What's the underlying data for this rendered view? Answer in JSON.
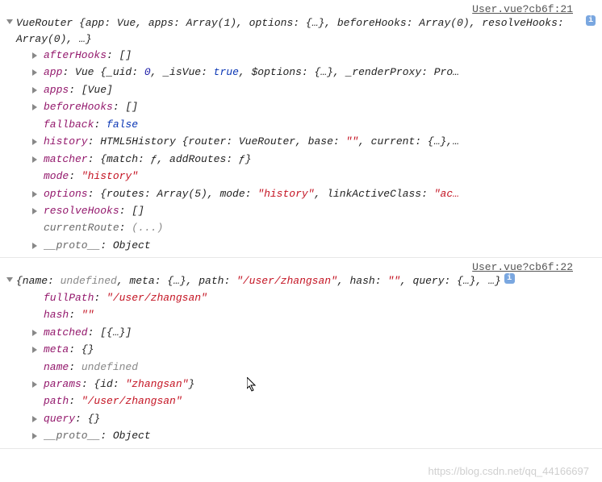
{
  "entries": [
    {
      "source": "User.vue?cb6f:21",
      "header": "VueRouter {app: Vue, apps: Array(1), options: {…}, beforeHooks: Array(0), resolveHooks: Array(0), …}",
      "props": [
        {
          "expandable": true,
          "key": "afterHooks",
          "keyClass": "p-key",
          "valueParts": [
            {
              "t": "[]",
              "c": "p-obj"
            }
          ]
        },
        {
          "expandable": true,
          "key": "app",
          "keyClass": "p-key",
          "valueParts": [
            {
              "t": "Vue {_uid: ",
              "c": "p-obj"
            },
            {
              "t": "0",
              "c": "p-num"
            },
            {
              "t": ", _isVue: ",
              "c": "p-obj"
            },
            {
              "t": "true",
              "c": "p-bool"
            },
            {
              "t": ", $options: {…}, _renderProxy: Pro…",
              "c": "p-obj"
            }
          ]
        },
        {
          "expandable": true,
          "key": "apps",
          "keyClass": "p-key",
          "valueParts": [
            {
              "t": "[Vue]",
              "c": "p-obj"
            }
          ]
        },
        {
          "expandable": true,
          "key": "beforeHooks",
          "keyClass": "p-key",
          "valueParts": [
            {
              "t": "[]",
              "c": "p-obj"
            }
          ]
        },
        {
          "expandable": false,
          "key": "fallback",
          "keyClass": "p-key",
          "valueParts": [
            {
              "t": "false",
              "c": "p-bool"
            }
          ]
        },
        {
          "expandable": true,
          "key": "history",
          "keyClass": "p-key",
          "valueParts": [
            {
              "t": "HTML5History {router: VueRouter, base: ",
              "c": "p-obj"
            },
            {
              "t": "\"\"",
              "c": "p-str"
            },
            {
              "t": ", current: {…},…",
              "c": "p-obj"
            }
          ]
        },
        {
          "expandable": true,
          "key": "matcher",
          "keyClass": "p-key",
          "valueParts": [
            {
              "t": "{match: ",
              "c": "p-obj"
            },
            {
              "t": "ƒ",
              "c": "p-func"
            },
            {
              "t": ", addRoutes: ",
              "c": "p-obj"
            },
            {
              "t": "ƒ",
              "c": "p-func"
            },
            {
              "t": "}",
              "c": "p-obj"
            }
          ]
        },
        {
          "expandable": false,
          "key": "mode",
          "keyClass": "p-key",
          "valueParts": [
            {
              "t": "\"history\"",
              "c": "p-str"
            }
          ]
        },
        {
          "expandable": true,
          "key": "options",
          "keyClass": "p-key",
          "valueParts": [
            {
              "t": "{routes: Array(5), mode: ",
              "c": "p-obj"
            },
            {
              "t": "\"history\"",
              "c": "p-str"
            },
            {
              "t": ", linkActiveClass: ",
              "c": "p-obj"
            },
            {
              "t": "\"ac…",
              "c": "p-str"
            }
          ]
        },
        {
          "expandable": true,
          "key": "resolveHooks",
          "keyClass": "p-key",
          "valueParts": [
            {
              "t": "[]",
              "c": "p-obj"
            }
          ]
        },
        {
          "expandable": false,
          "key": "currentRoute",
          "keyClass": "p-key-grey",
          "valueParts": [
            {
              "t": "(...)",
              "c": "ellipsis"
            }
          ]
        },
        {
          "expandable": true,
          "key": "__proto__",
          "keyClass": "p-key-grey",
          "valueParts": [
            {
              "t": "Object",
              "c": "p-obj"
            }
          ]
        }
      ]
    },
    {
      "source": "User.vue?cb6f:22",
      "header": "{name: undefined, meta: {…}, path: \"/user/zhangsan\", hash: \"\", query: {…}, …}",
      "headerParts": [
        {
          "t": "{name: ",
          "c": "p-obj"
        },
        {
          "t": "undefined",
          "c": "p-undef"
        },
        {
          "t": ", meta: {…}, path: ",
          "c": "p-obj"
        },
        {
          "t": "\"/user/zhangsan\"",
          "c": "p-str"
        },
        {
          "t": ", hash: ",
          "c": "p-obj"
        },
        {
          "t": "\"\"",
          "c": "p-str"
        },
        {
          "t": ", query: {…}, …}",
          "c": "p-obj"
        }
      ],
      "props": [
        {
          "expandable": false,
          "key": "fullPath",
          "keyClass": "p-key",
          "valueParts": [
            {
              "t": "\"/user/zhangsan\"",
              "c": "p-str"
            }
          ]
        },
        {
          "expandable": false,
          "key": "hash",
          "keyClass": "p-key",
          "valueParts": [
            {
              "t": "\"\"",
              "c": "p-str"
            }
          ]
        },
        {
          "expandable": true,
          "key": "matched",
          "keyClass": "p-key",
          "valueParts": [
            {
              "t": "[{…}]",
              "c": "p-obj"
            }
          ]
        },
        {
          "expandable": true,
          "key": "meta",
          "keyClass": "p-key",
          "valueParts": [
            {
              "t": "{}",
              "c": "p-obj"
            }
          ]
        },
        {
          "expandable": false,
          "key": "name",
          "keyClass": "p-key",
          "valueParts": [
            {
              "t": "undefined",
              "c": "p-undef"
            }
          ]
        },
        {
          "expandable": true,
          "key": "params",
          "keyClass": "p-key",
          "valueParts": [
            {
              "t": "{id: ",
              "c": "p-obj"
            },
            {
              "t": "\"zhangsan\"",
              "c": "p-str"
            },
            {
              "t": "}",
              "c": "p-obj"
            }
          ]
        },
        {
          "expandable": false,
          "key": "path",
          "keyClass": "p-key",
          "valueParts": [
            {
              "t": "\"/user/zhangsan\"",
              "c": "p-str"
            }
          ]
        },
        {
          "expandable": true,
          "key": "query",
          "keyClass": "p-key",
          "valueParts": [
            {
              "t": "{}",
              "c": "p-obj"
            }
          ]
        },
        {
          "expandable": true,
          "key": "__proto__",
          "keyClass": "p-key-grey",
          "valueParts": [
            {
              "t": "Object",
              "c": "p-obj"
            }
          ]
        }
      ]
    }
  ],
  "watermark": "https://blog.csdn.net/qq_44166697",
  "infoBadgeLabel": "i"
}
